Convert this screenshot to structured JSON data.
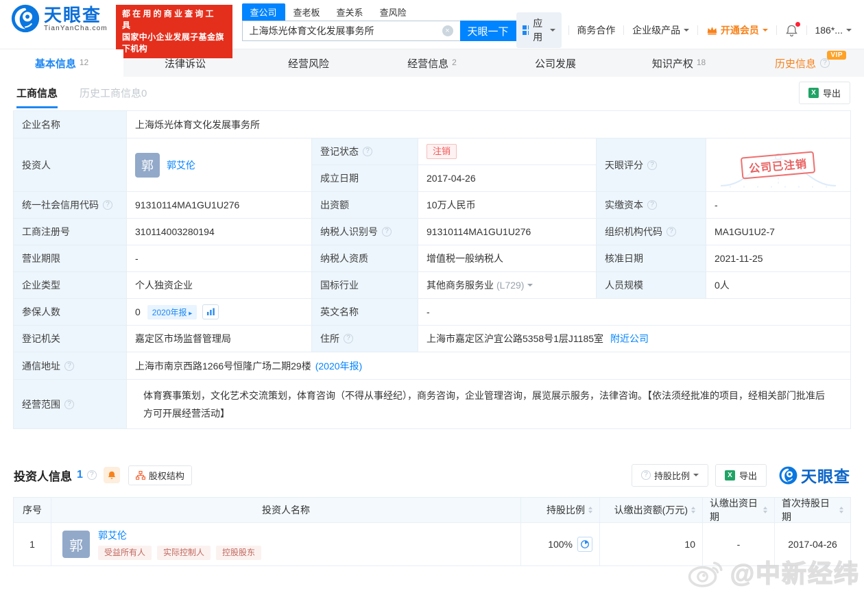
{
  "header": {
    "logo": {
      "title": "天眼查",
      "domain": "TianYanCha.com"
    },
    "slogan": {
      "line1": "都在用的商业查询工具",
      "line2": "国家中小企业发展子基金旗下机构"
    },
    "search": {
      "tabs": [
        {
          "label": "查公司"
        },
        {
          "label": "查老板"
        },
        {
          "label": "查关系"
        },
        {
          "label": "查风险"
        }
      ],
      "value": "上海烁光体育文化发展事务所",
      "button": "天眼一下"
    },
    "nav": {
      "apps": "应用",
      "business": "商务合作",
      "enterprise": "企业级产品",
      "vip": "开通会员",
      "phone": "186*..."
    }
  },
  "nav_tabs": [
    {
      "label": "基本信息",
      "count": "12"
    },
    {
      "label": "法律诉讼",
      "count": ""
    },
    {
      "label": "经营风险",
      "count": ""
    },
    {
      "label": "经营信息",
      "count": "2"
    },
    {
      "label": "公司发展",
      "count": ""
    },
    {
      "label": "知识产权",
      "count": "18"
    },
    {
      "label": "历史信息",
      "count": "",
      "vip_badge": "VIP"
    }
  ],
  "toolbar": {
    "subtabs": [
      {
        "label": "工商信息",
        "count": ""
      },
      {
        "label": "历史工商信息",
        "count": "0"
      }
    ],
    "export_label": "导出"
  },
  "info": {
    "company_name": {
      "label": "企业名称",
      "value": "上海烁光体育文化发展事务所"
    },
    "investor": {
      "label": "投资人",
      "avatar": "郭",
      "name": "郭艾伦"
    },
    "reg_status": {
      "label": "登记状态",
      "badge": "注销"
    },
    "established": {
      "label": "成立日期",
      "value": "2017-04-26"
    },
    "score": {
      "label": "天眼评分",
      "stamp": "公司已注销"
    },
    "grid_rows": [
      [
        {
          "label": "统一社会信用代码",
          "value": "91310114MA1GU1U276"
        },
        {
          "label": "出资额",
          "value": "10万人民币"
        },
        {
          "label": "实缴资本",
          "value": "-"
        }
      ],
      [
        {
          "label": "工商注册号",
          "value": "310114003280194"
        },
        {
          "label": "纳税人识别号",
          "value": "91310114MA1GU1U276"
        },
        {
          "label": "组织机构代码",
          "value": "MA1GU1U2-7"
        }
      ],
      [
        {
          "label": "营业期限",
          "value": "-"
        },
        {
          "label": "纳税人资质",
          "value": "增值税一般纳税人"
        },
        {
          "label": "核准日期",
          "value": "2021-11-25"
        }
      ],
      [
        {
          "label": "企业类型",
          "value": "个人独资企业"
        },
        {
          "label": "国标行业",
          "value": "其他商务服务业",
          "code": "(L729)"
        },
        {
          "label": "人员规模",
          "value": "0人"
        }
      ]
    ],
    "insured": {
      "label": "参保人数",
      "value": "0",
      "report_badge": "2020年报"
    },
    "english_name": {
      "label": "英文名称",
      "value": "-"
    },
    "registry": {
      "label": "登记机关",
      "value": "嘉定区市场监督管理局"
    },
    "residence": {
      "label": "住所",
      "value": "上海市嘉定区沪宜公路5358号1层J1185室",
      "nearby_link": "附近公司"
    },
    "mail_address": {
      "label": "通信地址",
      "value": "上海市南京西路1266号恒隆广场二期29楼",
      "report_link": "(2020年报)"
    },
    "business_scope": {
      "label": "经营范围",
      "value": "体育赛事策划，文化艺术交流策划，体育咨询（不得从事经纪），商务咨询，企业管理咨询，展览展示服务，法律咨询。【依法须经批准的项目，经相关部门批准后方可开展经营活动】"
    }
  },
  "investors": {
    "title": "投资人信息",
    "count": "1",
    "equity_button": "股权结构",
    "ratio_button": "持股比例",
    "export_button": "导出",
    "brand": "天眼查",
    "table": {
      "headers": [
        "序号",
        "投资人名称",
        "持股比例",
        "认缴出资额(万元)",
        "认缴出资日期",
        "首次持股日期"
      ],
      "rows": [
        {
          "index": "1",
          "avatar": "郭",
          "name": "郭艾伦",
          "tags": [
            "受益所有人",
            "实际控制人",
            "控股股东"
          ],
          "ratio": "100%",
          "amount": "10",
          "date": "-",
          "first_date": "2017-04-26"
        }
      ]
    }
  },
  "watermark": {
    "text": "@中新经纬"
  },
  "colors": {
    "accent": "#0084ff",
    "brand_red": "#e42f1d",
    "vip_orange": "#f7821b",
    "status_red": "#f25656",
    "label_bg": "#edf6fd"
  }
}
